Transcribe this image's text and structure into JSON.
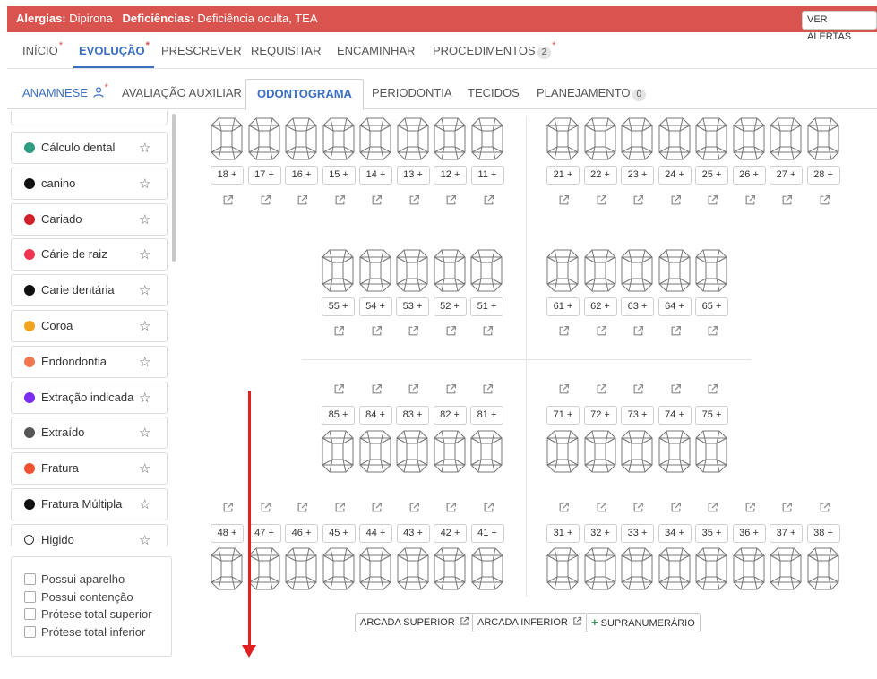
{
  "alerts": {
    "allergies_label": "Alergias:",
    "allergies_value": "Dipirona",
    "deficiencies_label": "Deficiências:",
    "deficiencies_value": "Deficiência oculta, TEA",
    "button": "VER ALERTAS"
  },
  "main_tabs": [
    {
      "label": "INÍCIO",
      "star": "*"
    },
    {
      "label": "EVOLUÇÃO",
      "star": "*",
      "active": true
    },
    {
      "label": "PRESCREVER"
    },
    {
      "label": "REQUISITAR"
    },
    {
      "label": "ENCAMINHAR"
    },
    {
      "label": "PROCEDIMENTOS",
      "badge": "2",
      "star": "*"
    }
  ],
  "sub_tabs": [
    {
      "label": "ANAMNESE",
      "star": "*"
    },
    {
      "label": "AVALIAÇÃO AUXILIAR"
    },
    {
      "label": "ODONTOGRAMA",
      "active": true
    },
    {
      "label": "PERIODONTIA"
    },
    {
      "label": "TECIDOS"
    },
    {
      "label": "PLANEJAMENTO",
      "badge": "0"
    }
  ],
  "diagnoses": [
    {
      "label": "Cálculo dental",
      "color": "#2e9c80"
    },
    {
      "label": "canino",
      "color": "#111111"
    },
    {
      "label": "Cariado",
      "color": "#d0202a"
    },
    {
      "label": "Cárie de raiz",
      "color": "#f0344f"
    },
    {
      "label": "Carie dentária",
      "color": "#111111"
    },
    {
      "label": "Coroa",
      "color": "#f2a51f"
    },
    {
      "label": "Endondontia",
      "color": "#f07850"
    },
    {
      "label": "Extração indicada",
      "color": "#7a2cf0"
    },
    {
      "label": "Extraído",
      "color": "#555555"
    },
    {
      "label": "Fratura",
      "color": "#ef5030"
    },
    {
      "label": "Fratura Múltipla",
      "color": "#111111"
    },
    {
      "label": "Higido",
      "color": "#ffffff",
      "outline": "#333333"
    }
  ],
  "checkboxes": [
    "Possui aparelho",
    "Possui contenção",
    "Prótese total superior",
    "Prótese total inferior"
  ],
  "teeth": {
    "upper_right_permanent": [
      "18",
      "17",
      "16",
      "15",
      "14",
      "13",
      "12",
      "11"
    ],
    "upper_left_permanent": [
      "21",
      "22",
      "23",
      "24",
      "25",
      "26",
      "27",
      "28"
    ],
    "upper_right_deciduous": [
      "55",
      "54",
      "53",
      "52",
      "51"
    ],
    "upper_left_deciduous": [
      "61",
      "62",
      "63",
      "64",
      "65"
    ],
    "lower_right_deciduous": [
      "85",
      "84",
      "83",
      "82",
      "81"
    ],
    "lower_left_deciduous": [
      "71",
      "72",
      "73",
      "74",
      "75"
    ],
    "lower_right_permanent": [
      "48",
      "47",
      "46",
      "45",
      "44",
      "43",
      "42",
      "41"
    ],
    "lower_left_permanent": [
      "31",
      "32",
      "33",
      "34",
      "35",
      "36",
      "37",
      "38"
    ],
    "add_symbol": "+"
  },
  "bottom_buttons": {
    "upper_arch": "ARCADA SUPERIOR",
    "lower_arch": "ARCADA INFERIOR",
    "supernumerary": "SUPRANUMERÁRIO"
  },
  "icons": {
    "favorite": "star-outline-icon",
    "external": "external-link-icon",
    "add": "plus-icon",
    "anamnese": "person-icon"
  },
  "colors": {
    "alert_bar": "#d9534f",
    "accent": "#3a6fc4",
    "annotation_arrow": "#e02020"
  }
}
